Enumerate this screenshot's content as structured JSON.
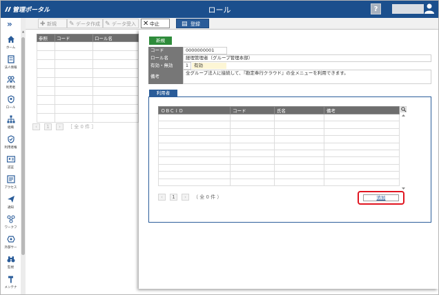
{
  "header": {
    "brand": "管理ポータル",
    "title": "ロール",
    "help_label": "?"
  },
  "sidebar": {
    "collapse_label": "»",
    "items": [
      {
        "label": "ホーム",
        "icon": "home-icon"
      },
      {
        "label": "法人情報",
        "icon": "building-icon"
      },
      {
        "label": "利用者",
        "icon": "users-icon"
      },
      {
        "label": "ロール",
        "icon": "role-icon"
      },
      {
        "label": "組織",
        "icon": "org-chart-icon"
      },
      {
        "label": "利用者権",
        "icon": "shield-check-icon"
      },
      {
        "label": "認証",
        "icon": "id-card-icon"
      },
      {
        "label": "アクセス",
        "icon": "access-icon"
      },
      {
        "label": "通知",
        "icon": "paper-plane-icon"
      },
      {
        "label": "ワークフ",
        "icon": "workflow-icon"
      },
      {
        "label": "外部サー",
        "icon": "external-service-icon"
      },
      {
        "label": "監視",
        "icon": "binoculars-icon"
      },
      {
        "label": "メンテナ",
        "icon": "hammer-icon"
      }
    ]
  },
  "toolbar": {
    "new_label": "新規",
    "data_create_label": "データ作成",
    "data_import_label": "データ受入",
    "cancel_label": "中止",
    "register_label": "登録"
  },
  "list": {
    "columns": [
      "参照",
      "コード",
      "ロール名"
    ],
    "pager": {
      "page": "1",
      "summary": "［ 全 0 件 ］"
    }
  },
  "detail": {
    "badge": "新規",
    "fields": {
      "code_label": "コード",
      "code_value": "0000000001",
      "role_name_label": "ロール名",
      "role_name_value": "経理管理者（グループ管理本部）",
      "active_label": "有効・無効",
      "active_code": "1",
      "active_text": "有効",
      "remarks_label": "備考",
      "remarks_value": "全グループ法人に接続して、『勘定奉行クラウド』の全メニューを利用できます。"
    },
    "users_tab": "利用者",
    "users_table": {
      "columns": [
        "ＯＢＣｉＤ",
        "コード",
        "氏名",
        "備考"
      ]
    },
    "users_pager": {
      "page": "1",
      "summary": "（ 全 0 件 ）"
    },
    "add_label": "追加"
  },
  "colors": {
    "header_bg": "#1b4f8d",
    "accent": "#2a5c99",
    "badge_green": "#2e8b3a",
    "highlight_red": "#e0141f"
  }
}
